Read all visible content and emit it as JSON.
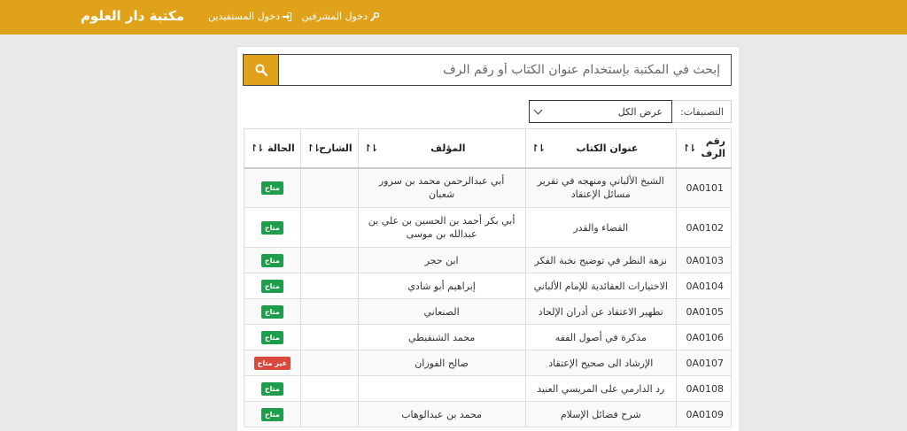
{
  "navbar": {
    "brand_bold": "مكتبة",
    "brand_rest": "دار العلوم",
    "links": [
      {
        "label": "دخول المستفيدين",
        "icon": "login-icon"
      },
      {
        "label": "دخول المشرفين",
        "icon": "key-icon"
      }
    ]
  },
  "search": {
    "placeholder": "إبحث في المكتبة بإستخدام عنوان الكتاب أو رقم الرف"
  },
  "filter": {
    "label": "التصنيفات:",
    "selected": "عرض الكل"
  },
  "table": {
    "headers": {
      "id": "رقم الرف",
      "title": "عنوان الكتاب",
      "author": "المؤلف",
      "reader": "الشارح",
      "status": "الحالة"
    },
    "rows": [
      {
        "id": "0A0101",
        "title": "الشيخ الألباني ومنهجه في تقرير مسائل الإعتقاد",
        "author": "أبي عبدالرحمن محمد بن سرور شعبان",
        "reader": "",
        "status": "متاح",
        "available": true
      },
      {
        "id": "0A0102",
        "title": "القضاء والقدر",
        "author": "أبي بكر أحمد بن الحسين بن علي بن عبدالله بن موسى",
        "reader": "",
        "status": "متاح",
        "available": true
      },
      {
        "id": "0A0103",
        "title": "نزهة النظر في توضيح نخبة الفكر",
        "author": "ابن حجر",
        "reader": "",
        "status": "متاح",
        "available": true
      },
      {
        "id": "0A0104",
        "title": "الاختيارات العقائدية للإمام الألباني",
        "author": "إبراهيم أبو شادي",
        "reader": "",
        "status": "متاح",
        "available": true
      },
      {
        "id": "0A0105",
        "title": "تطهير الاعتقاد عن أدران الإلحاد",
        "author": "الصنعاني",
        "reader": "",
        "status": "متاح",
        "available": true
      },
      {
        "id": "0A0106",
        "title": "مذكرة في أصول الفقه",
        "author": "محمد الشنقيطي",
        "reader": "",
        "status": "متاح",
        "available": true
      },
      {
        "id": "0A0107",
        "title": "الإرشاد الى صحيح الإعتقاد",
        "author": "صالح الفوزان",
        "reader": "",
        "status": "غير متاح",
        "available": false
      },
      {
        "id": "0A0108",
        "title": "رد الدارمي على المريسي العنيد",
        "author": "",
        "reader": "",
        "status": "متاح",
        "available": true
      },
      {
        "id": "0A0109",
        "title": "شرح فضائل الإسلام",
        "author": "محمد بن عبدالوهاب",
        "reader": "",
        "status": "متاح",
        "available": true
      }
    ]
  },
  "colors": {
    "accent": "#e0a21a",
    "available": "#1e9e4a",
    "unavailable": "#d9483b"
  }
}
